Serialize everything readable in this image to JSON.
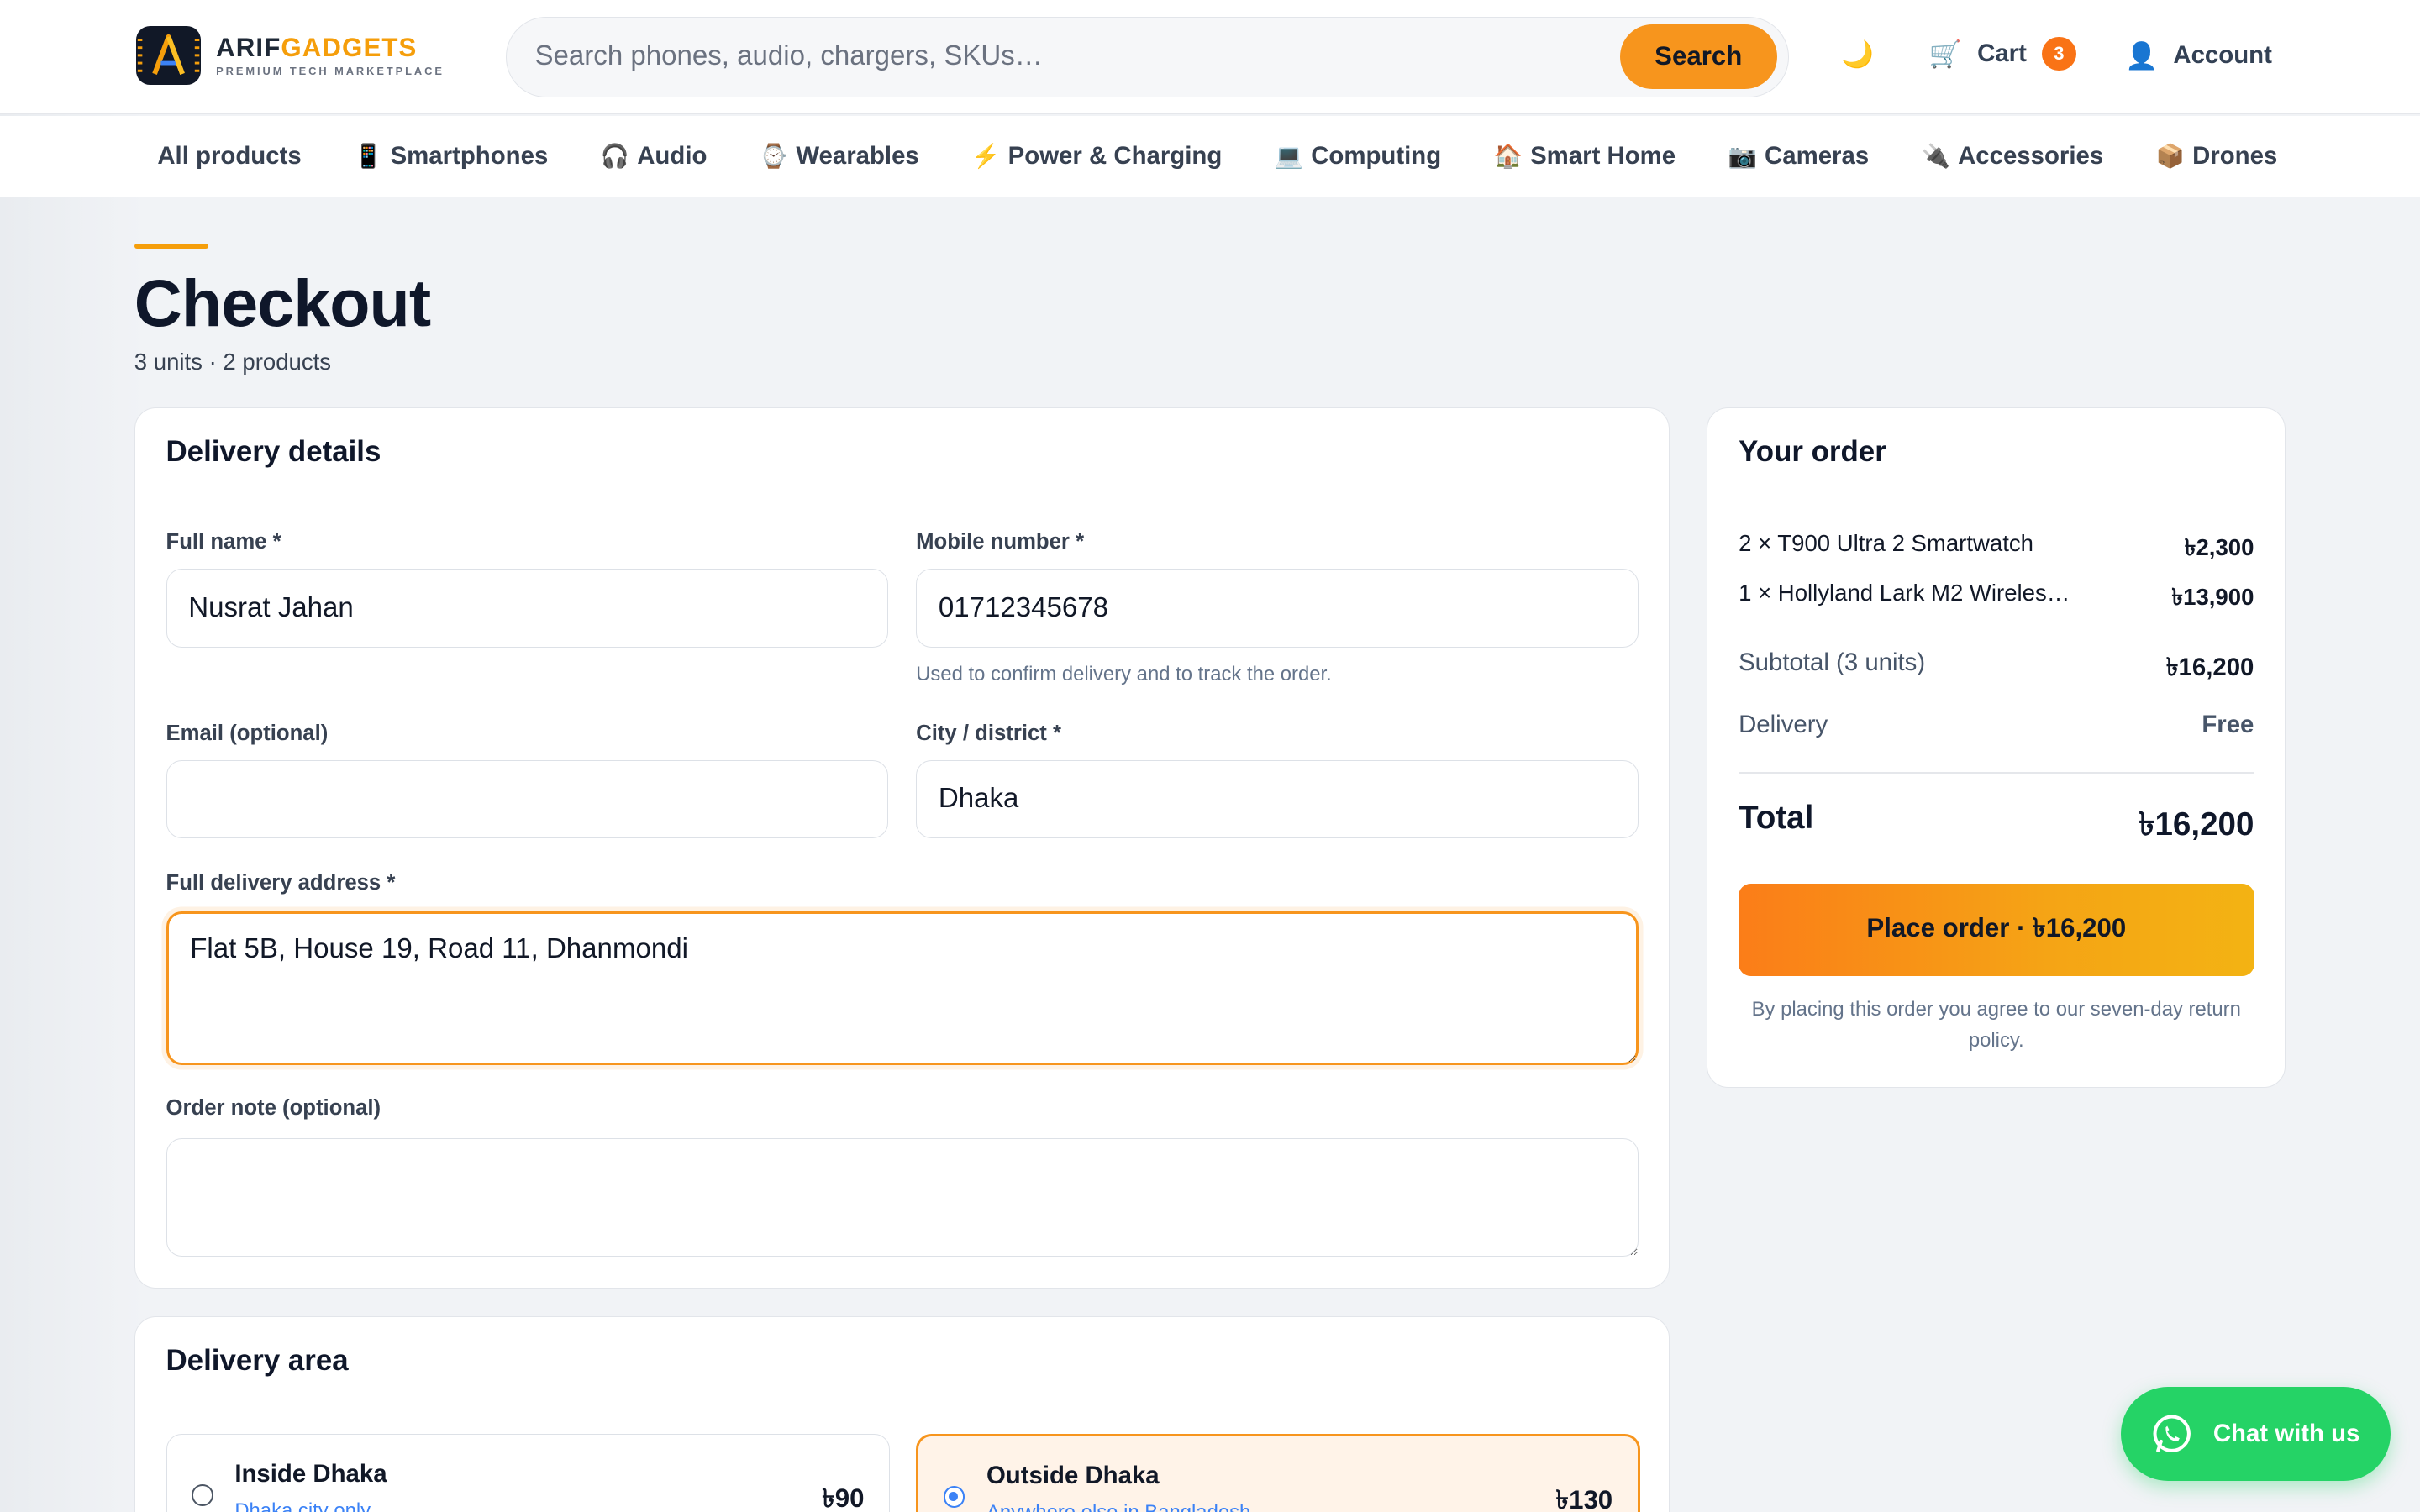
{
  "brand": {
    "name_part1": "ARIF",
    "name_part2": "GADGETS",
    "tagline": "PREMIUM TECH MARKETPLACE",
    "accent_color": "#f59e0b"
  },
  "search": {
    "placeholder": "Search phones, audio, chargers, SKUs…",
    "button_label": "Search"
  },
  "header": {
    "theme_toggle_icon": "moon-icon",
    "cart_label": "Cart",
    "cart_count": "3",
    "account_label": "Account"
  },
  "categories": [
    {
      "icon": "",
      "label": "All products"
    },
    {
      "icon": "📱",
      "label": "Smartphones"
    },
    {
      "icon": "🎧",
      "label": "Audio"
    },
    {
      "icon": "⌚",
      "label": "Wearables"
    },
    {
      "icon": "⚡",
      "label": "Power & Charging"
    },
    {
      "icon": "💻",
      "label": "Computing"
    },
    {
      "icon": "🏠",
      "label": "Smart Home"
    },
    {
      "icon": "📷",
      "label": "Cameras"
    },
    {
      "icon": "🔌",
      "label": "Accessories"
    },
    {
      "icon": "📦",
      "label": "Drones"
    }
  ],
  "page": {
    "title": "Checkout",
    "subtitle": "3 units · 2 products"
  },
  "delivery": {
    "heading": "Delivery details",
    "full_name_label": "Full name *",
    "full_name_value": "Nusrat Jahan",
    "mobile_label": "Mobile number *",
    "mobile_value": "01712345678",
    "mobile_hint": "Used to confirm delivery and to track the order.",
    "email_label": "Email (optional)",
    "email_value": "",
    "city_label": "City / district *",
    "city_value": "Dhaka",
    "address_label": "Full delivery address *",
    "address_value": "Flat 5B, House 19, Road 11, Dhanmondi",
    "note_label": "Order note (optional)",
    "note_value": ""
  },
  "area": {
    "heading": "Delivery area",
    "options": [
      {
        "name": "Inside Dhaka",
        "desc": "Dhaka city only",
        "price": "৳90",
        "selected": false
      },
      {
        "name": "Outside Dhaka",
        "desc": "Anywhere else in Bangladesh",
        "price": "৳130",
        "selected": true
      }
    ]
  },
  "order": {
    "heading": "Your order",
    "items": [
      {
        "label": "2 × T900 Ultra 2 Smartwatch",
        "amount": "৳2,300"
      },
      {
        "label": "1 × Hollyland Lark M2 Wireles…",
        "amount": "৳13,900"
      }
    ],
    "subtotal_label": "Subtotal (3 units)",
    "subtotal_value": "৳16,200",
    "delivery_label": "Delivery",
    "delivery_value": "Free",
    "total_label": "Total",
    "total_value": "৳16,200",
    "place_button": "Place order · ৳16,200",
    "terms": "By placing this order you agree to our seven-day return policy."
  },
  "chat": {
    "label": "Chat with us",
    "color": "#25d366"
  }
}
